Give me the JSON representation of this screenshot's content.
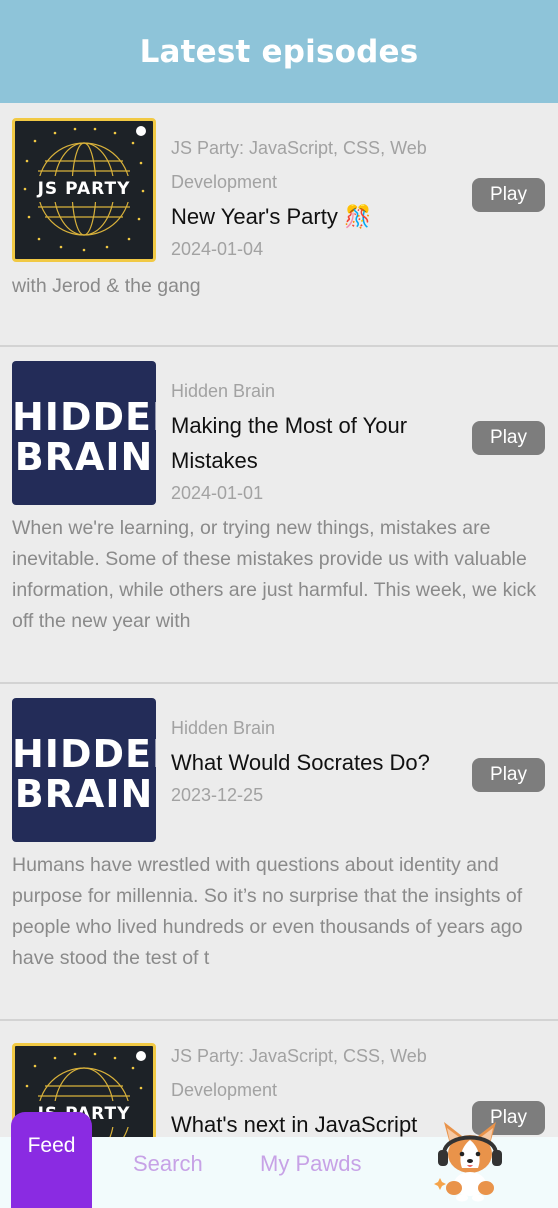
{
  "header": {
    "title": "Latest episodes"
  },
  "episodes": [
    {
      "podcast": "JS Party: JavaScript, CSS, Web Development",
      "title": "New Year's Party 🎊",
      "date": "2024-01-04",
      "description": "with Jerod & the gang",
      "play_label": "Play",
      "artwork_text": "JS PARTY",
      "artwork_badge": "c"
    },
    {
      "podcast": "Hidden Brain",
      "title": "Making the Most of Your Mistakes",
      "date": "2024-01-01",
      "description": "When we're learning, or trying new things, mistakes are inevitable. Some of these mistakes provide us with valuable information, while others are just harmful. This week, we kick off the new year with",
      "play_label": "Play",
      "artwork_text_1": "HIDDEN",
      "artwork_text_2": "BRAIN"
    },
    {
      "podcast": "Hidden Brain",
      "title": "What Would Socrates Do?",
      "date": "2023-12-25",
      "description": "Humans have wrestled with questions about identity and purpose for millennia. So it’s no surprise that the insights of people who lived hundreds or even thousands of years ago have stood the test of t",
      "play_label": "Play",
      "artwork_text_1": "HIDDEN",
      "artwork_text_2": "BRAIN"
    },
    {
      "podcast": "JS Party: JavaScript, CSS, Web Development",
      "title": "What's next in JavaScript",
      "play_label": "Play",
      "artwork_text": "JS PARTY",
      "artwork_badge": "c"
    }
  ],
  "nav": {
    "feed_label": "Feed",
    "search_label": "Search",
    "mypawds_label": "My Pawds"
  },
  "colors": {
    "header_bg": "#8ec4d9",
    "accent": "#8a2be2",
    "nav_inactive": "#c7a2e6",
    "play_bg": "#7d7d7d"
  },
  "icons": {
    "mascot": "corgi-headphones-icon"
  }
}
